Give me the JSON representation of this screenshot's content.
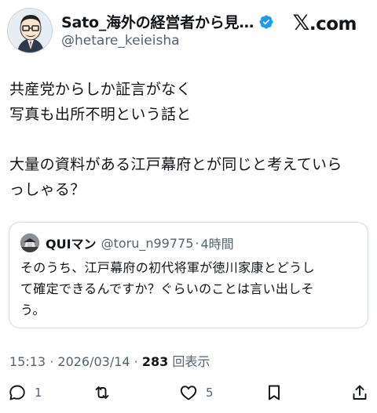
{
  "author": {
    "name": "Sato_海外の経営者から見…",
    "handle": "@hetare_keieisha"
  },
  "brand": {
    "x_mark": "𝕏",
    "label": ".com"
  },
  "tweet": {
    "lines": [
      "共産党からしか証言がなく",
      "写真も出所不明という話と",
      "",
      "大量の資料がある江戸幕府とが同じと考えていら",
      "っしゃる？"
    ]
  },
  "quote": {
    "name": "QUIマン",
    "handle": "@toru_n99775",
    "separator": "·",
    "time": "4時間",
    "lines": [
      "そのうち、江戸幕府の初代将軍が徳川家康とどうし",
      "て確定できるんですか？ぐらいのことは言い出しそ",
      "う。"
    ]
  },
  "meta": {
    "time": "15:13",
    "sep1": "·",
    "date": "2026/03/14",
    "sep2": "·",
    "views": "283",
    "views_label": "回表示"
  },
  "actions": {
    "reply_count": "1",
    "retweet_count": "",
    "like_count": "5"
  },
  "colors": {
    "text": "#0f1419",
    "secondary": "#536471",
    "border": "#cfd9de",
    "verified": "#1d9bf0"
  }
}
